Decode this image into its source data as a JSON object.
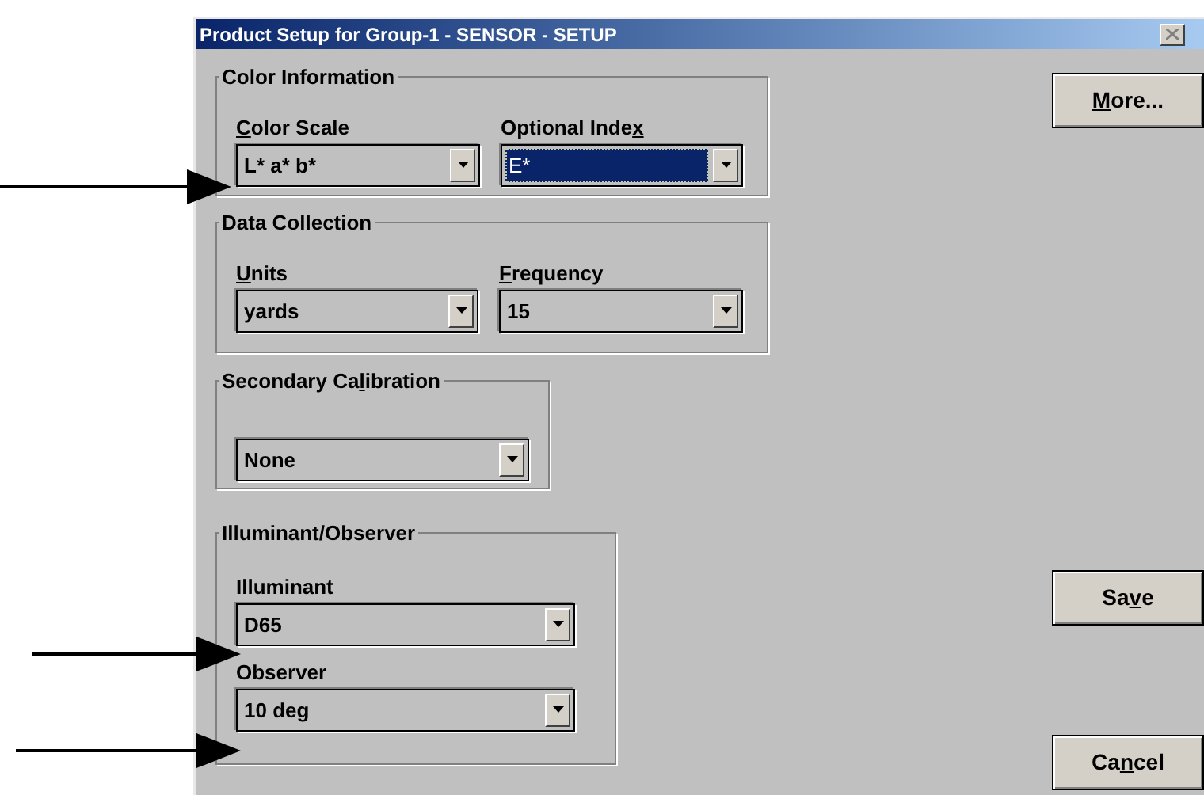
{
  "window": {
    "title": "Product Setup for Group-1 - SENSOR - SETUP"
  },
  "groups": [
    {
      "title": {
        "after": "Color Information"
      },
      "kind": "row",
      "fields": [
        {
          "label": {
            "key": "C",
            "after": "olor Scale"
          },
          "value": "L* a* b*",
          "selected": false
        },
        {
          "label": {
            "before": "Optional Inde",
            "key": "x"
          },
          "value": "E*",
          "selected": true
        }
      ]
    },
    {
      "title": {
        "after": "Data Collection"
      },
      "kind": "row",
      "fields": [
        {
          "label": {
            "key": "U",
            "after": "nits"
          },
          "value": "yards",
          "selected": false
        },
        {
          "label": {
            "key": "F",
            "after": "requency"
          },
          "value": "15",
          "selected": false
        }
      ]
    },
    {
      "title": {
        "before": "Secondary Ca",
        "key": "l",
        "after": "ibration"
      },
      "kind": "row",
      "fields": [
        {
          "value": "None",
          "selected": false
        }
      ]
    },
    {
      "title": {
        "after": "Illuminant/Observer"
      },
      "kind": "stack",
      "fields": [
        {
          "label": {
            "after": "Illuminant"
          },
          "value": "D65",
          "selected": false
        },
        {
          "label": {
            "after": "Observer"
          },
          "value": "10 deg",
          "selected": false
        }
      ]
    }
  ],
  "buttons": [
    {
      "label": {
        "key": "M",
        "after": "ore..."
      }
    },
    {
      "label": {
        "before": "Sa",
        "key": "v",
        "after": "e"
      }
    },
    {
      "label": {
        "before": "Ca",
        "key": "n",
        "after": "cel"
      }
    }
  ]
}
